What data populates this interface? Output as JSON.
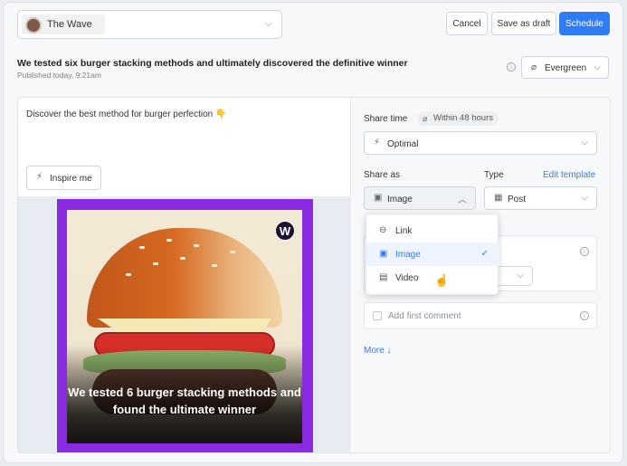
{
  "header": {
    "channel_name": "The Wave",
    "cancel_label": "Cancel",
    "draft_label": "Save as draft",
    "schedule_label": "Schedule"
  },
  "post": {
    "headline": "We tested six burger stacking methods and ultimately discovered the definitive winner",
    "published": "Published today, 9:21am",
    "evergreen_label": "Evergreen",
    "caption": "Discover the best method for burger perfection 👇",
    "inspire_label": "Inspire me",
    "image_overlay_text": "We tested 6 burger stacking methods and found the ultimate winner",
    "logo_letter": "W"
  },
  "settings": {
    "share_time_label": "Share time",
    "share_time_badge": "Within 48 hours",
    "optimal_label": "Optimal",
    "share_as_label": "Share as",
    "share_as_value": "Image",
    "type_label": "Type",
    "edit_template_label": "Edit template",
    "type_value": "Post",
    "first_comment_placeholder": "Add first comment",
    "more_label": "More ↓"
  },
  "share_as_menu": {
    "items": [
      {
        "label": "Link",
        "icon": "link-icon",
        "selected": false
      },
      {
        "label": "Image",
        "icon": "image-icon",
        "selected": true
      },
      {
        "label": "Video",
        "icon": "video-icon",
        "selected": false
      }
    ]
  },
  "colors": {
    "accent": "#2f7cf6",
    "image_frame": "#8a2be2"
  }
}
